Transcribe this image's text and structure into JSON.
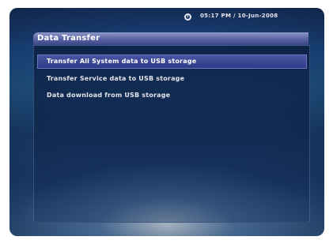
{
  "header": {
    "datetime": "05:17 PM / 10-Jun-2008"
  },
  "window": {
    "title": "Data Transfer"
  },
  "menu": {
    "items": [
      {
        "label": "Transfer All System data to USB storage",
        "selected": true
      },
      {
        "label": "Transfer Service data to USB storage",
        "selected": false
      },
      {
        "label": "Data download from USB storage",
        "selected": false
      }
    ]
  },
  "icons": {
    "clock": "clock-icon"
  },
  "colors": {
    "title_bar": "#5c66a5",
    "selected_item": "#3a4594",
    "background": "#1a3e6e"
  }
}
